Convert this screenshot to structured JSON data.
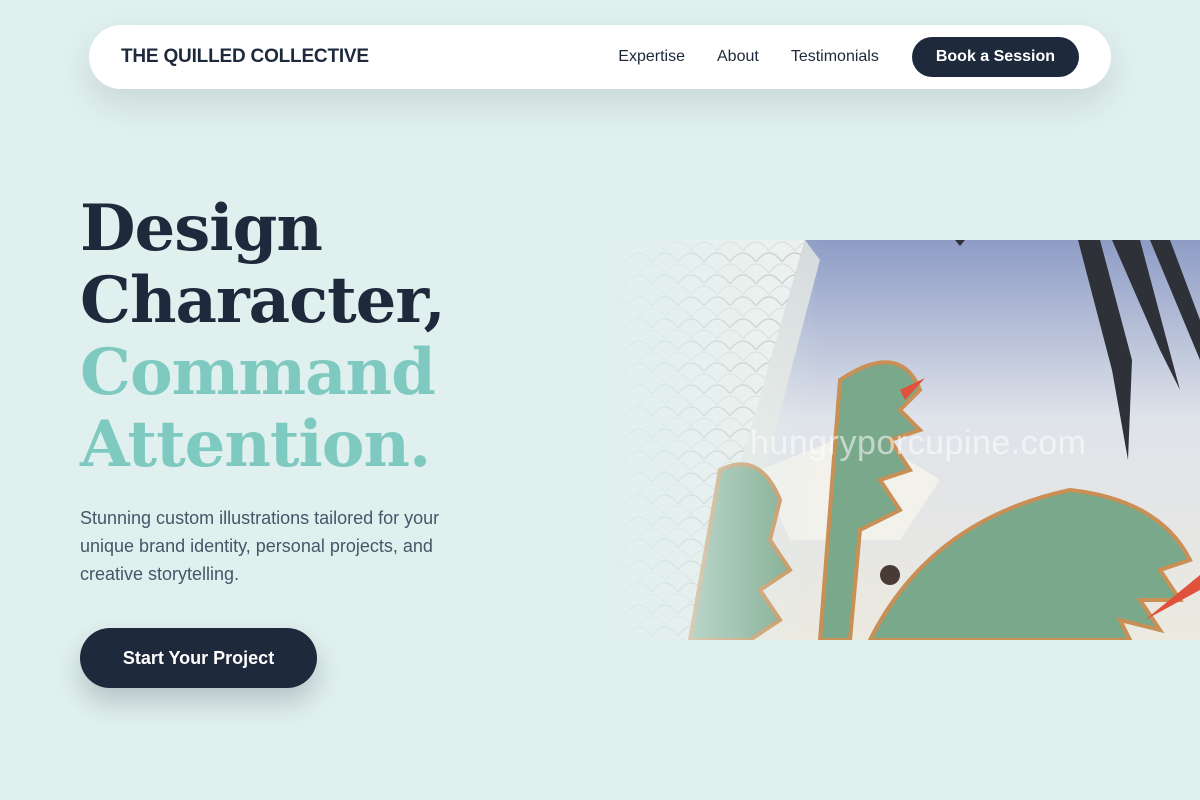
{
  "nav": {
    "brand": "THE QUILLED COLLECTIVE",
    "links": [
      {
        "label": "Expertise"
      },
      {
        "label": "About"
      },
      {
        "label": "Testimonials"
      }
    ],
    "cta_label": "Book a Session"
  },
  "hero": {
    "title_lines_dark": [
      "Design",
      "Character,"
    ],
    "title_lines_accent": [
      "Command",
      "Attention."
    ],
    "subtitle": "Stunning custom illustrations tailored for your unique brand identity, personal projects, and creative storytelling.",
    "cta_label": "Start Your Project"
  },
  "artwork": {
    "watermark": "hungryporcupine.com"
  },
  "colors": {
    "background": "#e0f0ee",
    "dark": "#1e293b",
    "accent": "#7fcac0",
    "body_text": "#475569"
  }
}
